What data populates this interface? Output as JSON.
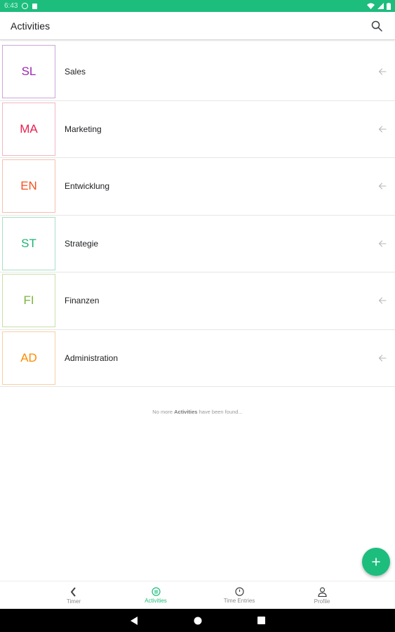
{
  "status_bar": {
    "time": "6:43"
  },
  "app_bar": {
    "title": "Activities",
    "search_icon": "search-icon"
  },
  "activities": [
    {
      "abbr": "SL",
      "name": "Sales",
      "color": "#9c27b0",
      "border": "#c9a8d8"
    },
    {
      "abbr": "MA",
      "name": "Marketing",
      "color": "#e91e4f",
      "border": "#f2b6c3"
    },
    {
      "abbr": "EN",
      "name": "Entwicklung",
      "color": "#f4511e",
      "border": "#f6c0ac"
    },
    {
      "abbr": "ST",
      "name": "Strategie",
      "color": "#1db373",
      "border": "#a8dfc4"
    },
    {
      "abbr": "FI",
      "name": "Finanzen",
      "color": "#7cb342",
      "border": "#c6e0a8"
    },
    {
      "abbr": "AD",
      "name": "Administration",
      "color": "#fb8c00",
      "border": "#f9cfa0"
    }
  ],
  "empty_message": {
    "prefix": "No more ",
    "bold": "Activities",
    "suffix": " have been found..."
  },
  "fab": {
    "icon": "plus-icon"
  },
  "bottom_nav": {
    "items": [
      {
        "label": "Timer",
        "icon": "timer-icon",
        "active": false
      },
      {
        "label": "Activities",
        "icon": "list-icon",
        "active": true
      },
      {
        "label": "Time Entries",
        "icon": "clock-icon",
        "active": false
      },
      {
        "label": "Profile",
        "icon": "person-icon",
        "active": false
      }
    ]
  },
  "colors": {
    "accent": "#1dbd7d",
    "text": "#202124",
    "muted": "#8a8a8a"
  }
}
